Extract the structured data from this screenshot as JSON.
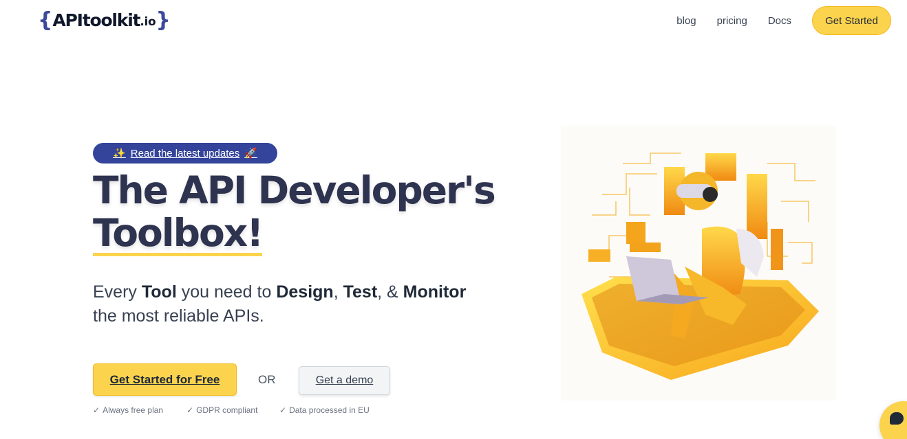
{
  "header": {
    "logo": {
      "open_brace": "{",
      "name": "APItoolkit",
      "tld": ".io",
      "close_brace": "}"
    },
    "nav": {
      "blog": "blog",
      "pricing": "pricing",
      "docs": "Docs",
      "cta": "Get Started"
    }
  },
  "hero": {
    "badge": {
      "emoji_left": "✨",
      "label": "Read the latest updates",
      "emoji_right": "🚀"
    },
    "headline_line1": "The API Developer's",
    "headline_line2": "Toolbox!",
    "sub": {
      "t1": "Every ",
      "b1": "Tool",
      "t2": " you need to ",
      "b2": "Design",
      "t3": ", ",
      "b3": "Test",
      "t4": ", & ",
      "b4": "Monitor",
      "t5": "the most reliable APIs."
    },
    "cta_primary": "Get Started for Free",
    "or_label": "OR",
    "cta_demo": "Get a demo",
    "checks": [
      {
        "mark": "✓",
        "label": "Always free plan"
      },
      {
        "mark": "✓",
        "label": "GDPR compliant"
      },
      {
        "mark": "✓",
        "label": "Data processed in EU"
      }
    ]
  },
  "colors": {
    "accent_yellow": "#fcd34d",
    "badge_blue": "#33449a",
    "headline": "#2e3350"
  },
  "icons": {
    "illustration": "developer-vr-laptop-illustration",
    "chat": "chat-bubble-icon"
  }
}
